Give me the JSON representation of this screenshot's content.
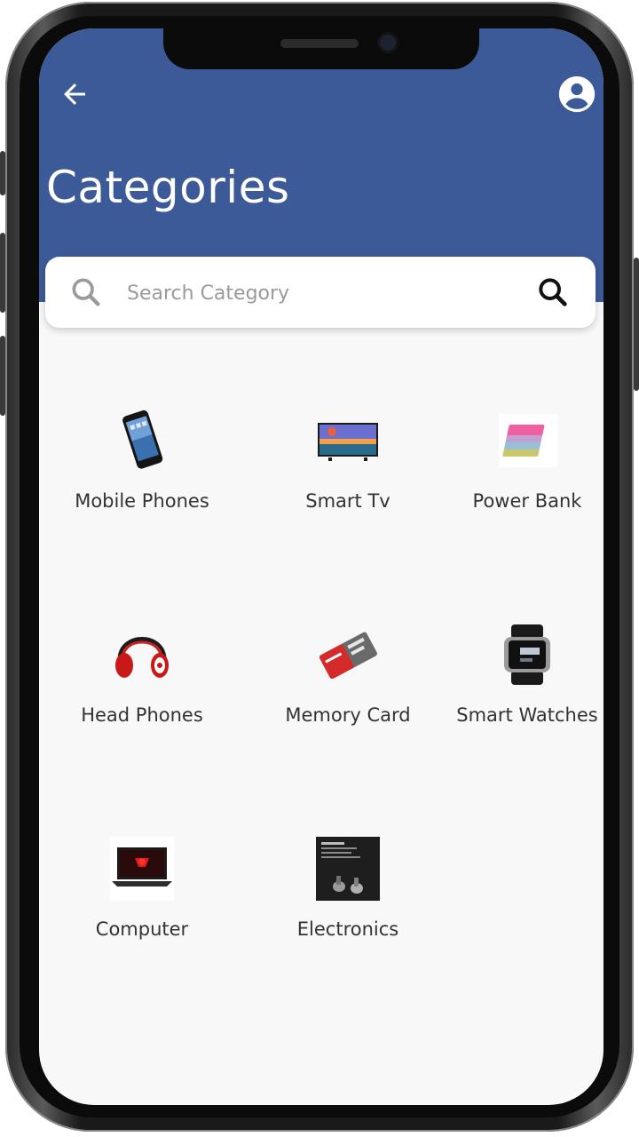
{
  "header": {
    "title": "Categories",
    "back_icon": "arrow-left-icon",
    "profile_icon": "account-circle-icon",
    "background_color": "#3d5a98"
  },
  "search": {
    "placeholder": "Search Category",
    "value": "",
    "left_icon": "search-icon",
    "button_icon": "search-icon"
  },
  "categories": [
    {
      "label": "Mobile Phones",
      "icon": "mobile-phone-icon"
    },
    {
      "label": "Smart Tv",
      "icon": "smart-tv-icon"
    },
    {
      "label": "Power Bank",
      "icon": "power-bank-icon"
    },
    {
      "label": "Head Phones",
      "icon": "headphones-icon"
    },
    {
      "label": "Memory Card",
      "icon": "memory-card-icon"
    },
    {
      "label": "Smart Watches",
      "icon": "smart-watch-icon"
    },
    {
      "label": "Computer",
      "icon": "laptop-icon"
    },
    {
      "label": "Electronics",
      "icon": "electronics-box-icon"
    }
  ]
}
